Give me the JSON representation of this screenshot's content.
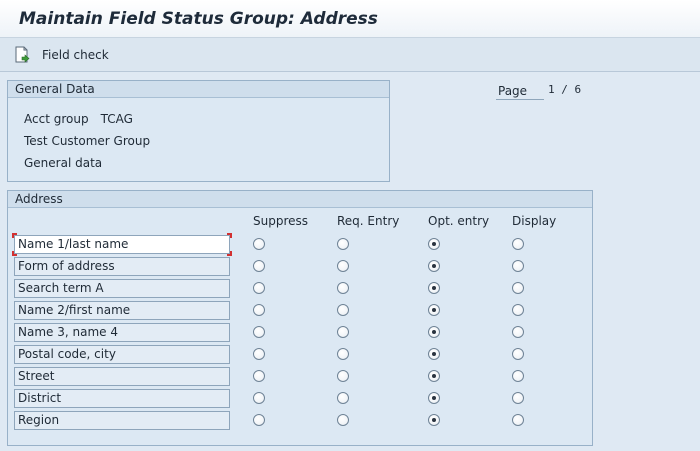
{
  "title": "Maintain Field Status Group: Address",
  "toolbar": {
    "field_check_label": "Field check",
    "field_check_icon": "document-check-icon"
  },
  "general_data": {
    "header": "General Data",
    "acct_group_label": "Acct group",
    "acct_group_value": "TCAG",
    "group_description": "Test Customer Group",
    "section_name": "General data"
  },
  "page": {
    "label": "Page",
    "value": "1 / 6"
  },
  "address": {
    "header": "Address",
    "columns": [
      "Suppress",
      "Req. Entry",
      "Opt. entry",
      "Display"
    ],
    "rows": [
      {
        "label": "Name 1/last name",
        "selected": "Opt. entry"
      },
      {
        "label": "Form of address",
        "selected": "Opt. entry"
      },
      {
        "label": "Search term A",
        "selected": "Opt. entry"
      },
      {
        "label": "Name 2/first name",
        "selected": "Opt. entry"
      },
      {
        "label": "Name 3, name 4",
        "selected": "Opt. entry"
      },
      {
        "label": "Postal code, city",
        "selected": "Opt. entry"
      },
      {
        "label": "Street",
        "selected": "Opt. entry"
      },
      {
        "label": "District",
        "selected": "Opt. entry"
      },
      {
        "label": "Region",
        "selected": "Opt. entry"
      }
    ]
  }
}
